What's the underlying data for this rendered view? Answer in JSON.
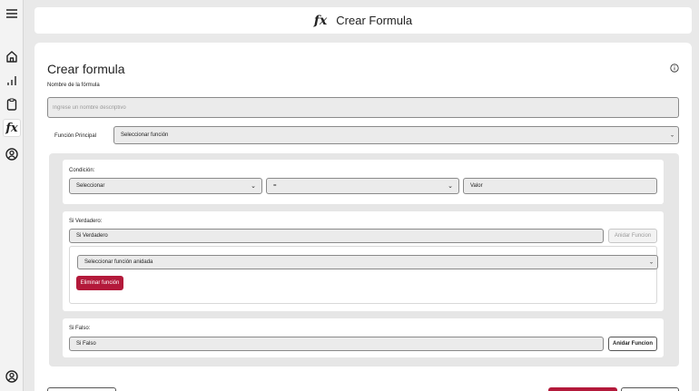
{
  "sidebar": {
    "icons": [
      "menu-icon",
      "home-icon",
      "bar-chart-icon",
      "clipboard-icon",
      "function-icon",
      "user-circle-icon",
      "user-circle-icon"
    ]
  },
  "header": {
    "fx": "fx",
    "title": "Crear Formula"
  },
  "form": {
    "title": "Crear formula",
    "name_label": "Nombre de la fórmula",
    "name_placeholder": "Ingrese un nombre descriptivo",
    "main_function_label": "Función Principal",
    "main_function_value": "Seleccionar función"
  },
  "condition": {
    "label": "Condición:",
    "field_value": "Seleccionar",
    "operator_value": "=",
    "value_placeholder": "Valor"
  },
  "if_true": {
    "label": "Si Verdadero:",
    "value": "Si Verdadero",
    "nest_button": "Anidar Funcion",
    "nested_select": "Seleccionar función anidada",
    "delete_button": "Eliminar función"
  },
  "if_false": {
    "label": "Si Falso:",
    "value": "Si Falso",
    "nest_button": "Anidar Funcion"
  },
  "colors": {
    "accent_red": "#b3193a"
  }
}
